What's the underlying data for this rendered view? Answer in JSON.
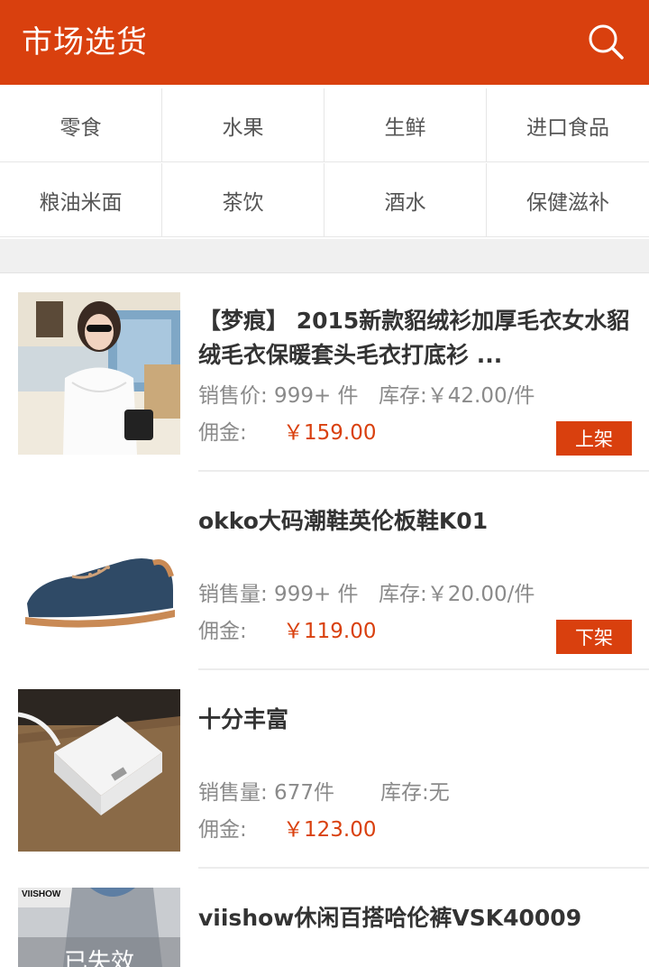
{
  "header": {
    "title": "市场选货",
    "search_icon": "search-icon"
  },
  "categories": {
    "row1": [
      "零食",
      "水果",
      "生鲜",
      "进口食品"
    ],
    "row2": [
      "粮油米面",
      "茶饮",
      "酒水",
      "保健滋补"
    ]
  },
  "products": [
    {
      "name": "【梦痕】 2015新款貂绒衫加厚毛衣女水貂绒毛衣保暖套头毛衣打底衫 ...",
      "sales": "销售价: 999+ 件",
      "stock": "库存:￥42.00/件",
      "commission_label": "佣金:",
      "commission": "￥159.00",
      "action": "上架"
    },
    {
      "name": "okko大码潮鞋英伦板鞋K01",
      "sales": "销售量: 999+ 件",
      "stock": "库存:￥20.00/件",
      "commission_label": "佣金:",
      "commission": "￥119.00",
      "action": "下架"
    },
    {
      "name": "十分丰富",
      "sales": "销售量: 677件",
      "stock": "库存:无",
      "commission_label": "佣金:",
      "commission": "￥123.00"
    },
    {
      "name": "viishow休闲百搭哈伦裤VSK40009",
      "thumb_brand": "VIISHOW",
      "thumb_overlay": "已失效"
    }
  ],
  "colors": {
    "brand": "#d9400e",
    "divider": "#ececec",
    "muted": "#8a8a8a"
  }
}
